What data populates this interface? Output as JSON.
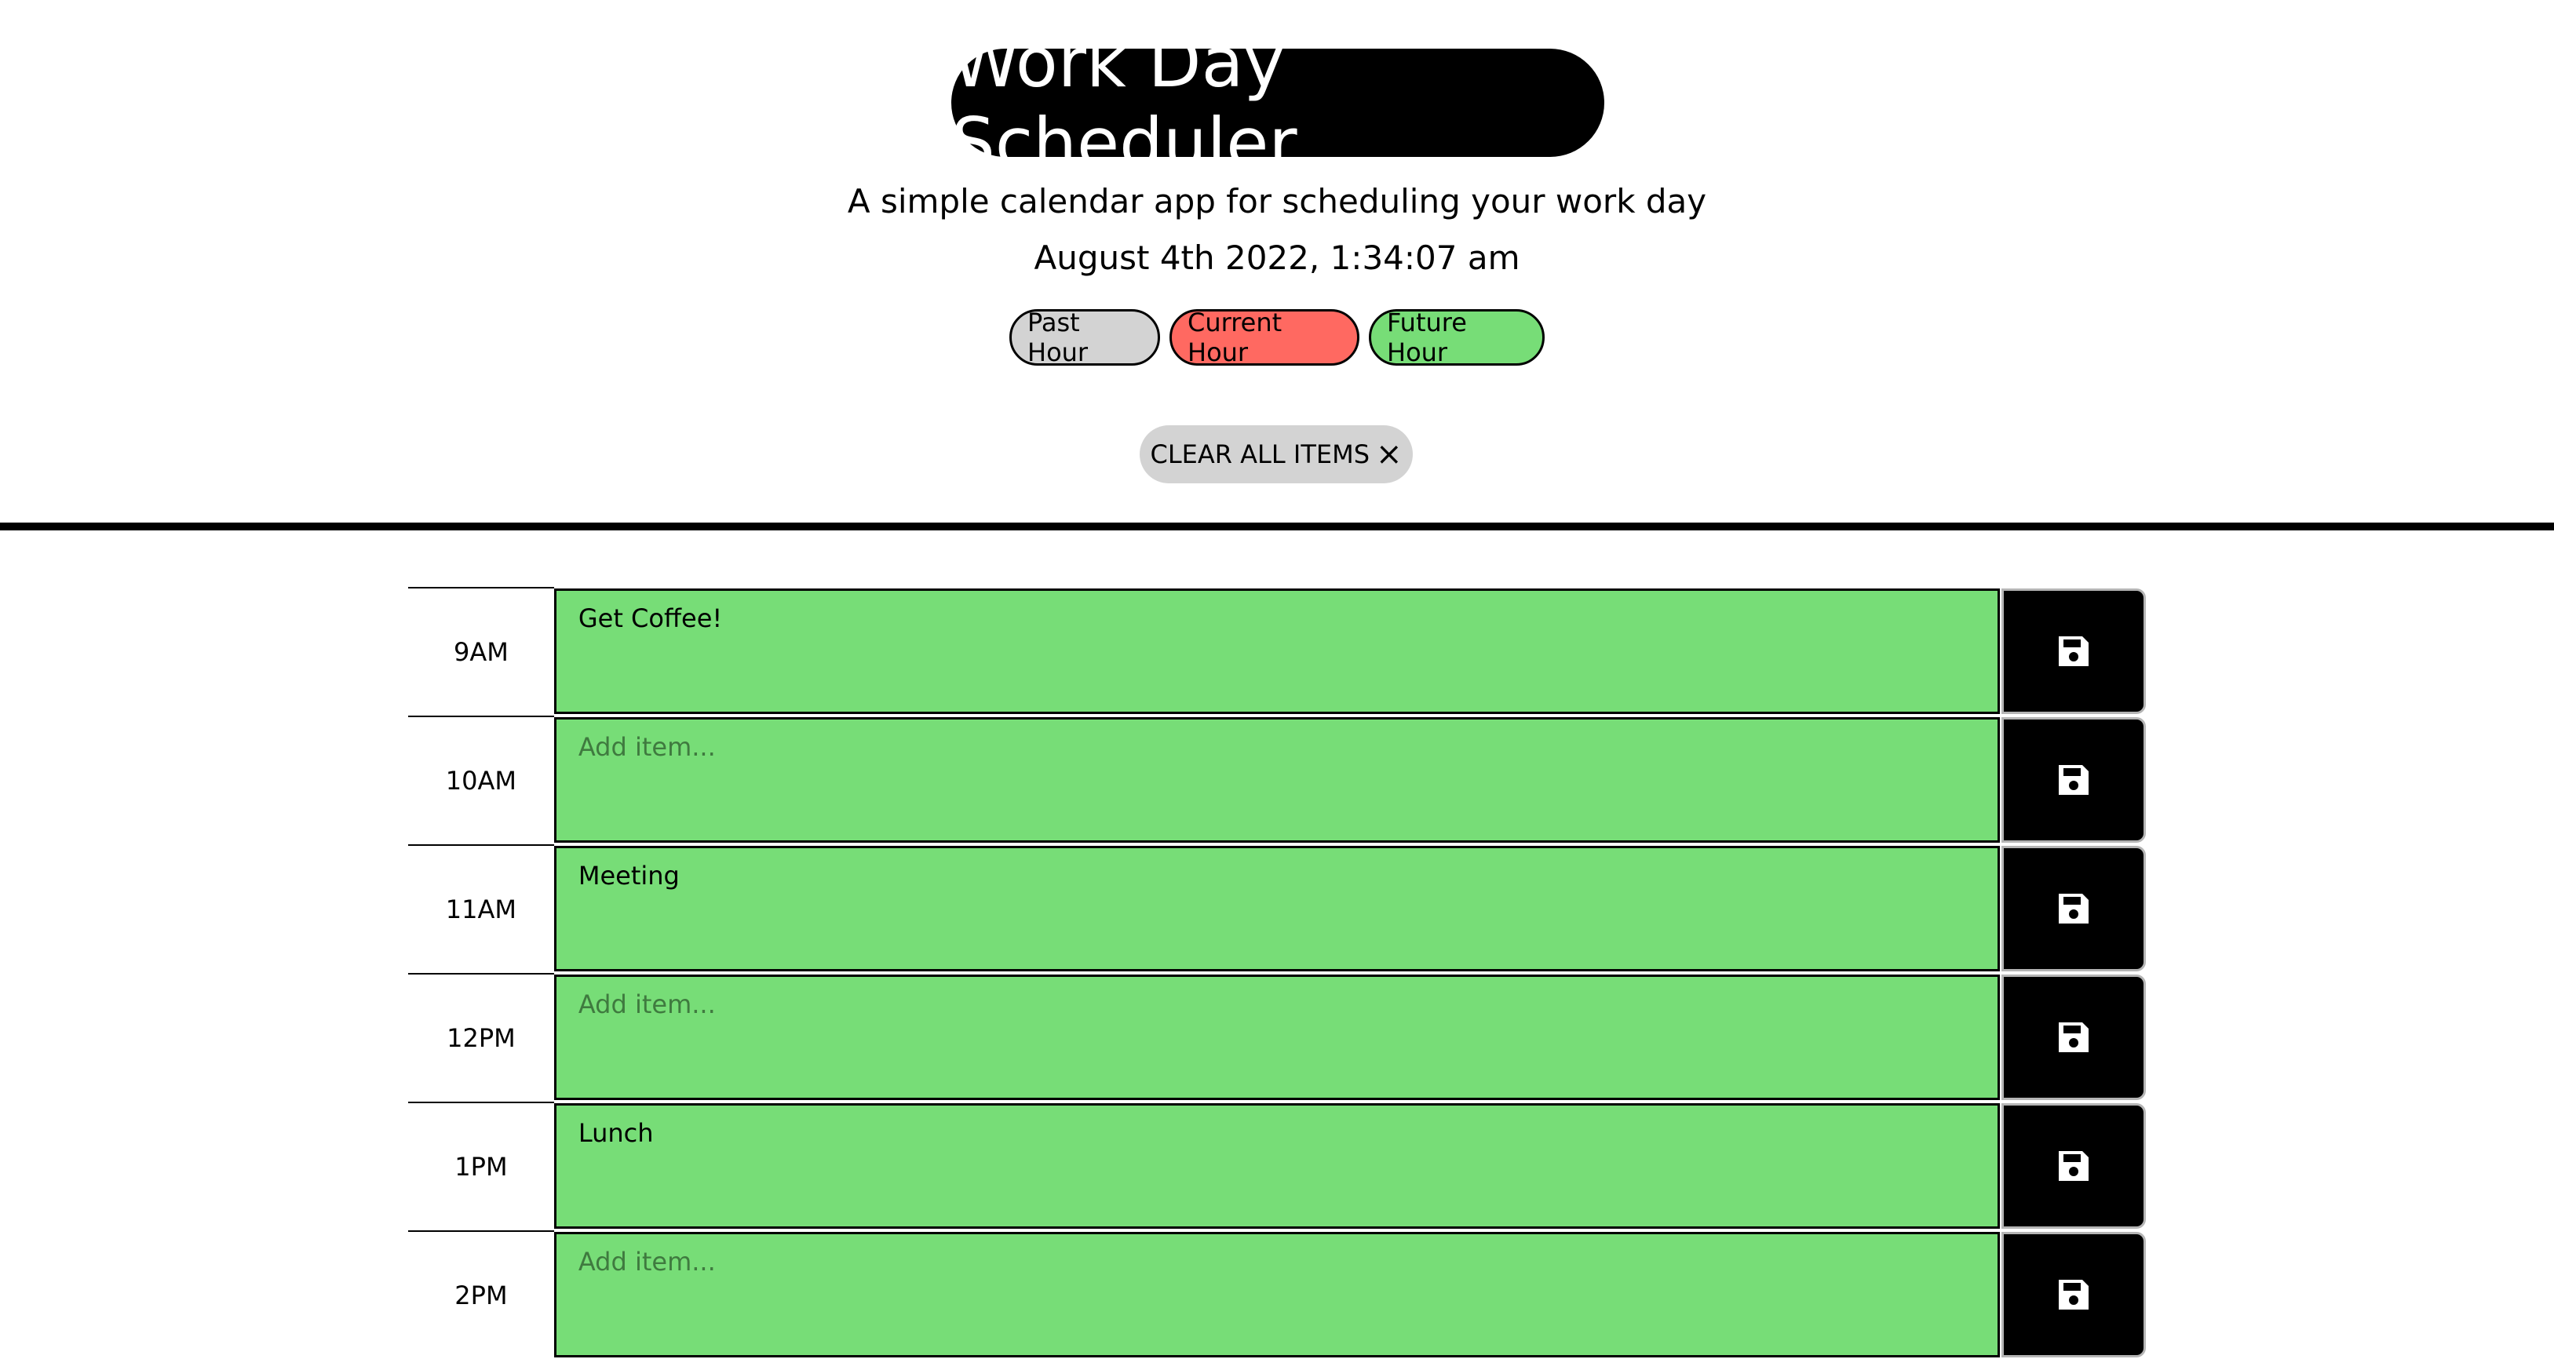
{
  "header": {
    "title": "Work Day Scheduler",
    "subtitle": "A simple calendar app for scheduling your work day",
    "datetime": "August 4th 2022, 1:34:07 am",
    "legend": {
      "past": "Past Hour",
      "current": "Current Hour",
      "future": "Future Hour"
    },
    "clear_label": "CLEAR ALL ITEMS",
    "clear_icon": "×"
  },
  "colors": {
    "past": "#d3d3d3",
    "current": "#ff6961",
    "future": "#77dd77",
    "accent": "#000000"
  },
  "rows": [
    {
      "hour": "9AM",
      "value": "Get Coffee!",
      "placeholder": "Add item...",
      "state": "future"
    },
    {
      "hour": "10AM",
      "value": "",
      "placeholder": "Add item...",
      "state": "future"
    },
    {
      "hour": "11AM",
      "value": "Meeting",
      "placeholder": "Add item...",
      "state": "future"
    },
    {
      "hour": "12PM",
      "value": "",
      "placeholder": "Add item...",
      "state": "future"
    },
    {
      "hour": "1PM",
      "value": "Lunch",
      "placeholder": "Add item...",
      "state": "future"
    },
    {
      "hour": "2PM",
      "value": "",
      "placeholder": "Add item...",
      "state": "future"
    }
  ],
  "icons": {
    "save": "floppy-disk-icon"
  }
}
